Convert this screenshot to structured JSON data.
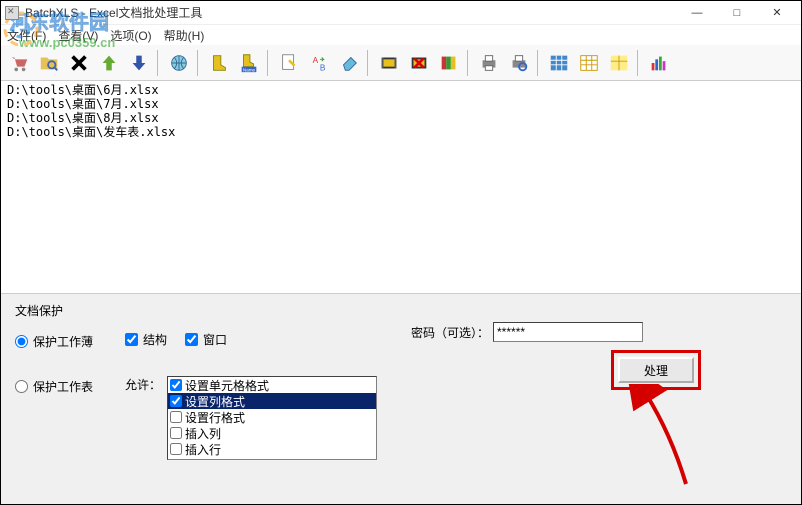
{
  "window": {
    "title": "BatchXLS - Excel文档批处理工具",
    "min": "—",
    "max": "□",
    "close": "✕"
  },
  "menu": {
    "file": "文件(F)",
    "view": "查看(V)",
    "option": "选项(O)",
    "help": "帮助(H)"
  },
  "files": [
    "D:\\tools\\桌面\\6月.xlsx",
    "D:\\tools\\桌面\\7月.xlsx",
    "D:\\tools\\桌面\\8月.xlsx",
    "D:\\tools\\桌面\\发车表.xlsx"
  ],
  "panel": {
    "title": "文档保护",
    "protect_workbook": "保护工作薄",
    "protect_sheet": "保护工作表",
    "structure": "结构",
    "window": "窗口",
    "allow_label": "允许：",
    "allow_options": [
      "设置单元格格式",
      "设置列格式",
      "设置行格式",
      "插入列",
      "插入行"
    ],
    "password_label": "密码（可选）：",
    "password_value": "******",
    "process_btn": "处理"
  },
  "watermark": {
    "line1": "河东软件园",
    "line2": "www.pc0359.cn"
  }
}
